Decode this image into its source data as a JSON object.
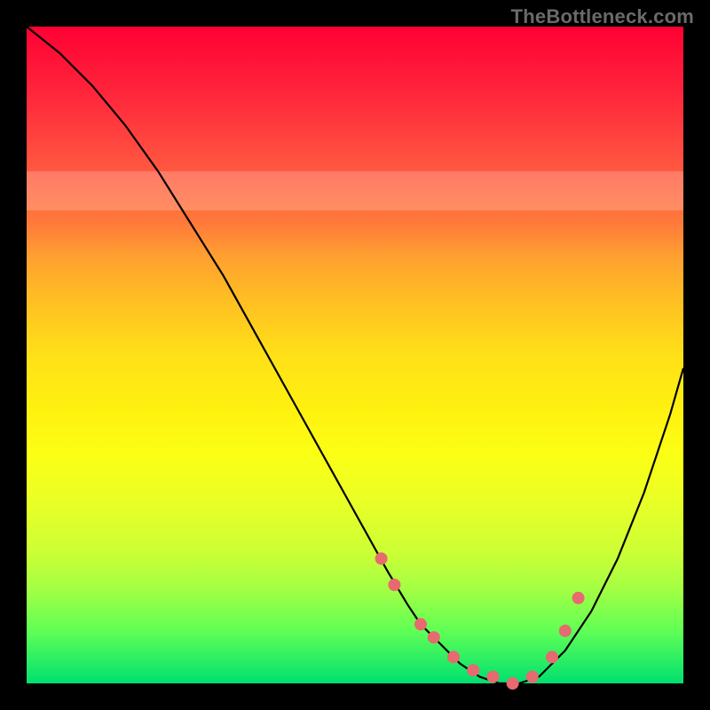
{
  "watermark": "TheBottleneck.com",
  "chart_data": {
    "type": "line",
    "title": "",
    "xlabel": "",
    "ylabel": "",
    "xlim": [
      0,
      100
    ],
    "ylim": [
      0,
      100
    ],
    "grid": false,
    "series": [
      {
        "name": "bottleneck-curve",
        "x": [
          0,
          5,
          10,
          15,
          20,
          25,
          30,
          35,
          40,
          45,
          50,
          55,
          58,
          60,
          63,
          66,
          69,
          72,
          75,
          78,
          82,
          86,
          90,
          94,
          98,
          100
        ],
        "values": [
          100,
          96,
          91,
          85,
          78,
          70,
          62,
          53,
          44,
          35,
          26,
          17,
          12,
          9,
          6,
          3,
          1,
          0,
          0,
          1,
          5,
          11,
          19,
          29,
          41,
          48
        ]
      }
    ],
    "markers": {
      "name": "highlight-dots",
      "x": [
        54,
        56,
        60,
        62,
        65,
        68,
        71,
        74,
        77,
        80,
        82,
        84
      ],
      "values": [
        19,
        15,
        9,
        7,
        4,
        2,
        1,
        0,
        1,
        4,
        8,
        13
      ],
      "color": "#e66a6f",
      "radius": 7
    },
    "bands": [
      {
        "y0": 72,
        "y1": 78,
        "alpha": 0.45
      }
    ]
  }
}
